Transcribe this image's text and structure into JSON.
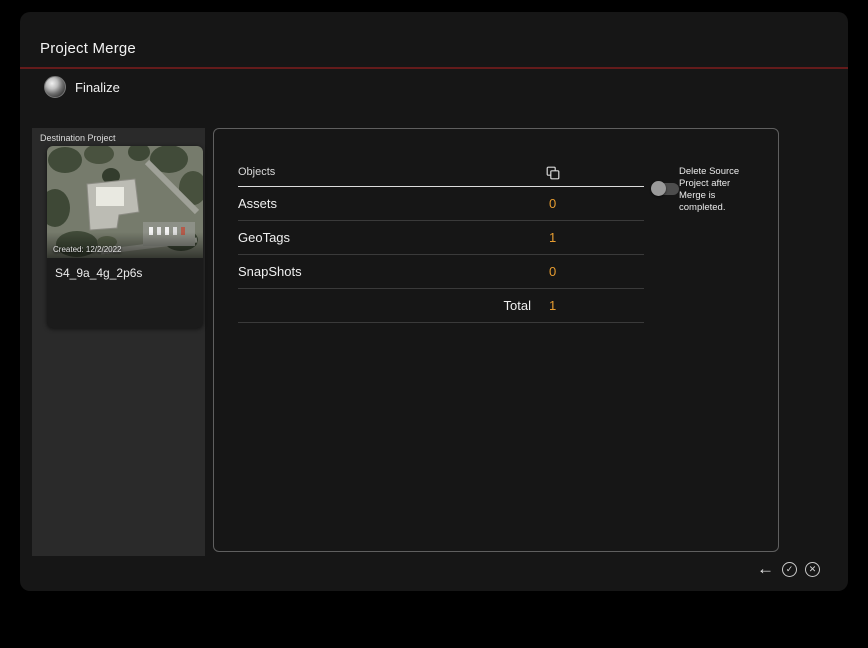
{
  "window": {
    "title": "Project Merge"
  },
  "wizard": {
    "step_label": "Finalize"
  },
  "destination_panel": {
    "heading": "Destination Project",
    "card": {
      "created": "Created: 12/2/2022",
      "name": "S4_9a_4g_2p6s"
    }
  },
  "objects_table": {
    "header": "Objects",
    "rows": [
      {
        "label": "Assets",
        "value": "0"
      },
      {
        "label": "GeoTags",
        "value": "1"
      },
      {
        "label": "SnapShots",
        "value": "0"
      }
    ],
    "total": {
      "label": "Total",
      "value": "1"
    }
  },
  "delete_toggle": {
    "label": "Delete Source Project after Merge is completed.",
    "state": "off"
  },
  "footer": {
    "back": "←",
    "confirm": "✓",
    "cancel": "✕"
  },
  "colors": {
    "accent": "#e69c30",
    "title_divider": "#641b1b"
  }
}
